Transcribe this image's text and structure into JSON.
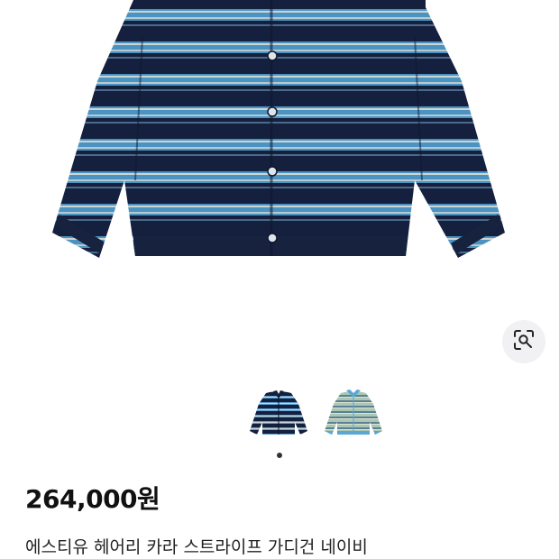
{
  "product": {
    "price": "264,000원",
    "title": "에스티유 헤어리 카라 스트라이프 가디건 네이비"
  },
  "gallery": {
    "thumbnails": [
      {
        "colorway": "navy-blue stripe",
        "selected": true
      },
      {
        "colorway": "mint-cream stripe",
        "selected": false
      }
    ],
    "page_indicator": {
      "current": 1
    }
  },
  "icons": {
    "lens": "image-search-icon"
  },
  "colors": {
    "navy": "#15203f",
    "sky": "#4a93c2",
    "cream": "#e6e2d4",
    "mint": "#a8c8b4",
    "thumb_blue": "#5aa7d6"
  }
}
